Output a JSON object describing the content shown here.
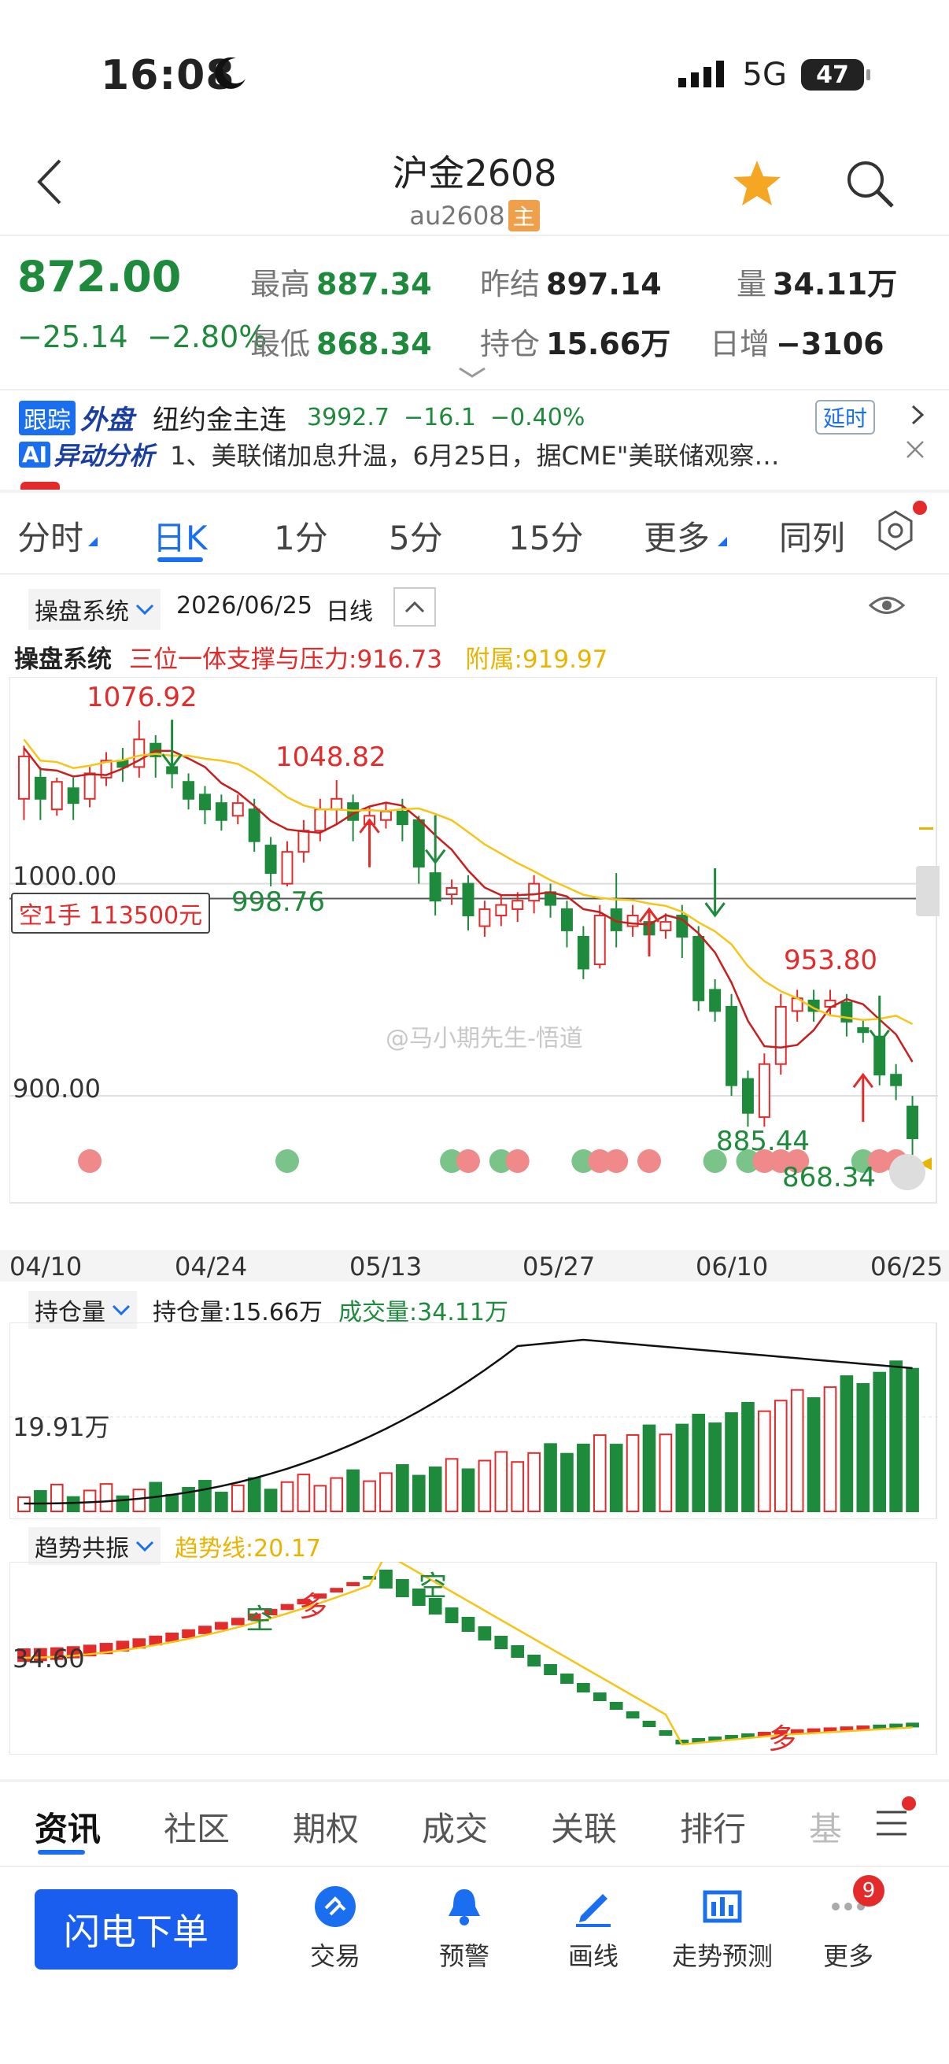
{
  "status_bar": {
    "time": "16:08",
    "network": "5G",
    "battery": "47"
  },
  "header": {
    "title": "沪金2608",
    "code": "au2608",
    "main_badge": "主"
  },
  "quote": {
    "price": "872.00",
    "change": "−25.14",
    "change_pct": "−2.80%",
    "high_label": "最高",
    "high": "887.34",
    "low_label": "最低",
    "low": "868.34",
    "prev_settle_label": "昨结",
    "prev_settle": "897.14",
    "open_interest_label": "持仓",
    "open_interest": "15.66万",
    "volume_label": "量",
    "volume": "34.11万",
    "daily_inc_label": "日增",
    "daily_inc": "−3106"
  },
  "ticker": {
    "tag1": "跟踪",
    "tag2": "外盘",
    "name": "纽约金主连",
    "price": "3992.7",
    "change": "−16.1",
    "pct": "−0.40%",
    "delay": "延时",
    "ai_tag": "AI",
    "ai_title": "异动分析",
    "ai_text": "1、美联储加息升温，6月25日，据CME\"美联储观察…"
  },
  "period_tabs": [
    "分时",
    "日K",
    "1分",
    "5分",
    "15分",
    "更多",
    "同列"
  ],
  "chart_toolbar": {
    "system": "操盘系统",
    "date": "2026/06/25",
    "period": "日线"
  },
  "indicator_line": {
    "name": "操盘系统",
    "support": "三位一体支撑与压力:916.73",
    "attach": "附属:919.97"
  },
  "position_box": "空1手 113500元",
  "watermark": "@马小期先生-悟道",
  "price_labels": {
    "p1076": "1076.92",
    "p1048": "1048.82",
    "p998": "998.76",
    "p953": "953.80",
    "p885": "885.44",
    "p868": "868.34",
    "y1000": "1000.00",
    "y900": "900.00"
  },
  "x_dates": [
    "04/10",
    "04/24",
    "05/13",
    "05/27",
    "06/10",
    "06/25"
  ],
  "volume_panel": {
    "selector": "持仓量",
    "oi": "持仓量:15.66万",
    "vol": "成交量:34.11万",
    "ylabel": "19.91万"
  },
  "trend_panel": {
    "selector": "趋势共振",
    "line": "趋势线:20.17",
    "ylabel": "34.60",
    "kong1": "空",
    "duo1": "多",
    "kong2": "空",
    "duo2": "多"
  },
  "bottom_tabs": [
    "资讯",
    "社区",
    "期权",
    "成交",
    "关联",
    "排行",
    "基"
  ],
  "order_button": "闪电下单",
  "nav": [
    {
      "label": "交易"
    },
    {
      "label": "预警"
    },
    {
      "label": "画线"
    },
    {
      "label": "走势预测"
    },
    {
      "label": "更多"
    }
  ],
  "more_badge": "9",
  "colors": {
    "up": "#e32b2b",
    "down": "#1e8a3c",
    "ma": "#f5c518",
    "accent": "#1a6ff0"
  },
  "chart_data": {
    "type": "candlestick",
    "ylim": [
      860,
      1090
    ],
    "candles": [
      [
        1040,
        1060,
        1030,
        1065
      ],
      [
        1050,
        1040,
        1030,
        1055
      ],
      [
        1035,
        1048,
        1032,
        1050
      ],
      [
        1045,
        1038,
        1030,
        1050
      ],
      [
        1040,
        1052,
        1036,
        1055
      ],
      [
        1050,
        1058,
        1046,
        1062
      ],
      [
        1058,
        1055,
        1048,
        1064
      ],
      [
        1055,
        1068,
        1050,
        1076.92
      ],
      [
        1066,
        1060,
        1050,
        1070
      ],
      [
        1055,
        1052,
        1045,
        1060
      ],
      [
        1048,
        1040,
        1035,
        1052
      ],
      [
        1042,
        1035,
        1028,
        1046
      ],
      [
        1038,
        1030,
        1025,
        1042
      ],
      [
        1032,
        1038,
        1028,
        1042
      ],
      [
        1035,
        1020,
        1015,
        1040
      ],
      [
        1018,
        1005,
        998.76,
        1022
      ],
      [
        1000,
        1015,
        998.76,
        1020
      ],
      [
        1015,
        1025,
        1010,
        1030
      ],
      [
        1025,
        1035,
        1020,
        1040
      ],
      [
        1035,
        1040,
        1028,
        1048.82
      ],
      [
        1038,
        1030,
        1020,
        1042
      ],
      [
        1028,
        1032,
        1022,
        1036
      ],
      [
        1030,
        1034,
        1026,
        1038
      ],
      [
        1034,
        1028,
        1020,
        1040
      ],
      [
        1030,
        1008,
        1000,
        1032
      ],
      [
        1005,
        992,
        985,
        1010
      ],
      [
        995,
        998,
        990,
        1002
      ],
      [
        1000,
        985,
        978,
        1004
      ],
      [
        980,
        988,
        975,
        992
      ],
      [
        985,
        990,
        980,
        995
      ],
      [
        988,
        992,
        982,
        996
      ],
      [
        992,
        1000,
        986,
        1004
      ],
      [
        996,
        990,
        984,
        1000
      ],
      [
        988,
        978,
        970,
        992
      ],
      [
        975,
        960,
        955,
        980
      ],
      [
        962,
        985,
        960,
        990
      ],
      [
        988,
        978,
        970,
        1005
      ],
      [
        980,
        985,
        975,
        990
      ],
      [
        982,
        976,
        970,
        986
      ],
      [
        978,
        982,
        974,
        986
      ],
      [
        985,
        975,
        965,
        990
      ],
      [
        975,
        945,
        940,
        980
      ],
      [
        950,
        940,
        935,
        955
      ],
      [
        942,
        905,
        900,
        948
      ],
      [
        908,
        892,
        885.44,
        912
      ],
      [
        890,
        915,
        885.44,
        920
      ],
      [
        915,
        942,
        910,
        948
      ],
      [
        940,
        946,
        935,
        950
      ],
      [
        945,
        940,
        935,
        950
      ],
      [
        942,
        945,
        938,
        950
      ],
      [
        944,
        935,
        928,
        948
      ],
      [
        932,
        930,
        925,
        936
      ],
      [
        928,
        910,
        905,
        932
      ],
      [
        910,
        905,
        898,
        915
      ],
      [
        895,
        880,
        868.34,
        900
      ]
    ],
    "ma_red_label": "三位一体支撑与压力",
    "ma_yellow_label": "附属"
  }
}
